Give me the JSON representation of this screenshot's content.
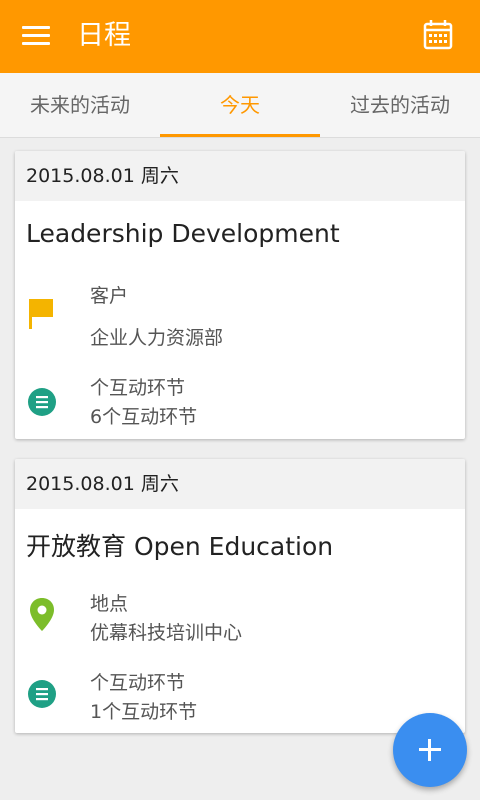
{
  "appbar": {
    "title": "日程",
    "menu_icon": "menu-icon",
    "calendar_icon": "calendar-icon",
    "accent": "#ff9800"
  },
  "tabs": [
    {
      "label": "未来的活动",
      "active": false
    },
    {
      "label": "今天",
      "active": true
    },
    {
      "label": "过去的活动",
      "active": false
    }
  ],
  "events": [
    {
      "date": "2015.08.01 周六",
      "title": "Leadership Development",
      "info_icon": "flag-icon",
      "info_label": "客户",
      "info_value": "企业人力资源部",
      "sessions_icon": "list-icon",
      "sessions_label": "个互动环节",
      "sessions_value": "6个互动环节"
    },
    {
      "date": "2015.08.01 周六",
      "title": "开放教育 Open Education",
      "info_icon": "location-pin-icon",
      "info_label": "地点",
      "info_value": "优幕科技培训中心",
      "sessions_icon": "list-icon",
      "sessions_label": "个互动环节",
      "sessions_value": "1个互动环节"
    }
  ],
  "fab": {
    "icon": "plus-icon",
    "color": "#3a8ef0"
  }
}
